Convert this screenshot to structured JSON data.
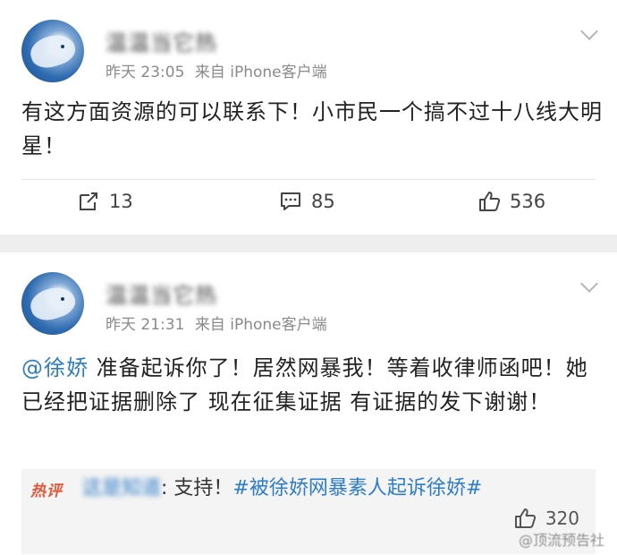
{
  "posts": [
    {
      "username": "温温当它热",
      "time": "昨天 23:05",
      "source": "来自 iPhone客户端",
      "content": "有这方面资源的可以联系下！小市民一个搞不过十八线大明星！",
      "stats": {
        "reposts": "13",
        "comments": "85",
        "likes": "536"
      }
    },
    {
      "username": "温温当它热",
      "time": "昨天 21:31",
      "source": "来自 iPhone客户端",
      "mention": "@徐娇",
      "content": " 准备起诉你了！居然网暴我！等着收律师函吧！她已经把证据删除了 现在征集证据 有证据的发下谢谢！",
      "hot_comment": {
        "badge": "热评",
        "user": "这是知道",
        "text": ": 支持！",
        "topic": "#被徐娇网暴素人起诉徐娇#",
        "likes": "320"
      }
    }
  ],
  "watermark": "@顶流预告社",
  "icons": [
    "repost-icon",
    "comment-icon",
    "like-icon",
    "chevron-down-icon"
  ]
}
